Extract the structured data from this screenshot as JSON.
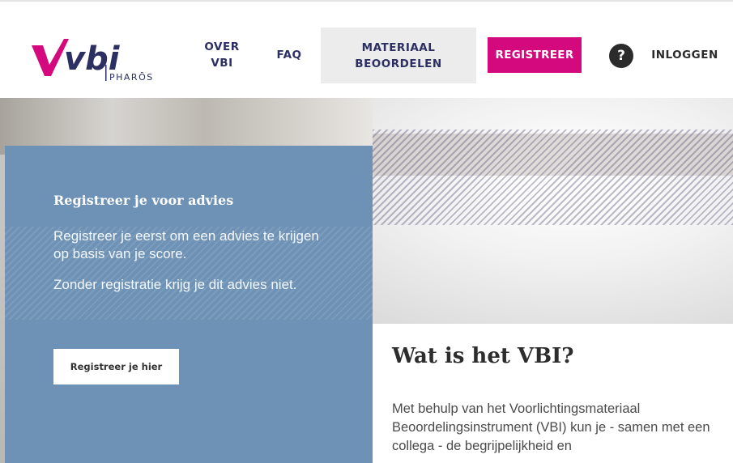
{
  "header": {
    "logo_text": "vbi",
    "logo_sub": "PHARŌS",
    "nav": [
      {
        "label": "OVER VBI"
      },
      {
        "label": "FAQ"
      },
      {
        "label": "MATERIAAL BEOORDELEN"
      }
    ],
    "register_label": "REGISTREER",
    "help_label": "?",
    "login_label": "INLOGGEN"
  },
  "panel": {
    "title": "Registreer je voor advies",
    "text1": "Registreer je eerst om een advies te krijgen op basis van je score.",
    "text2": "Zonder registratie krijg je dit advies niet.",
    "button_label": "Registreer je hier"
  },
  "card": {
    "title": "Wat is het VBI?",
    "text": "Met behulp van het Voorlichtingsmateriaal Beoordelingsinstrument (VBI) kun je - samen met een collega - de begrijpelijkheid en"
  },
  "colors": {
    "brand_pink": "#d4097d",
    "navy": "#2c2f62",
    "panel_blue": "#6e92b5"
  }
}
